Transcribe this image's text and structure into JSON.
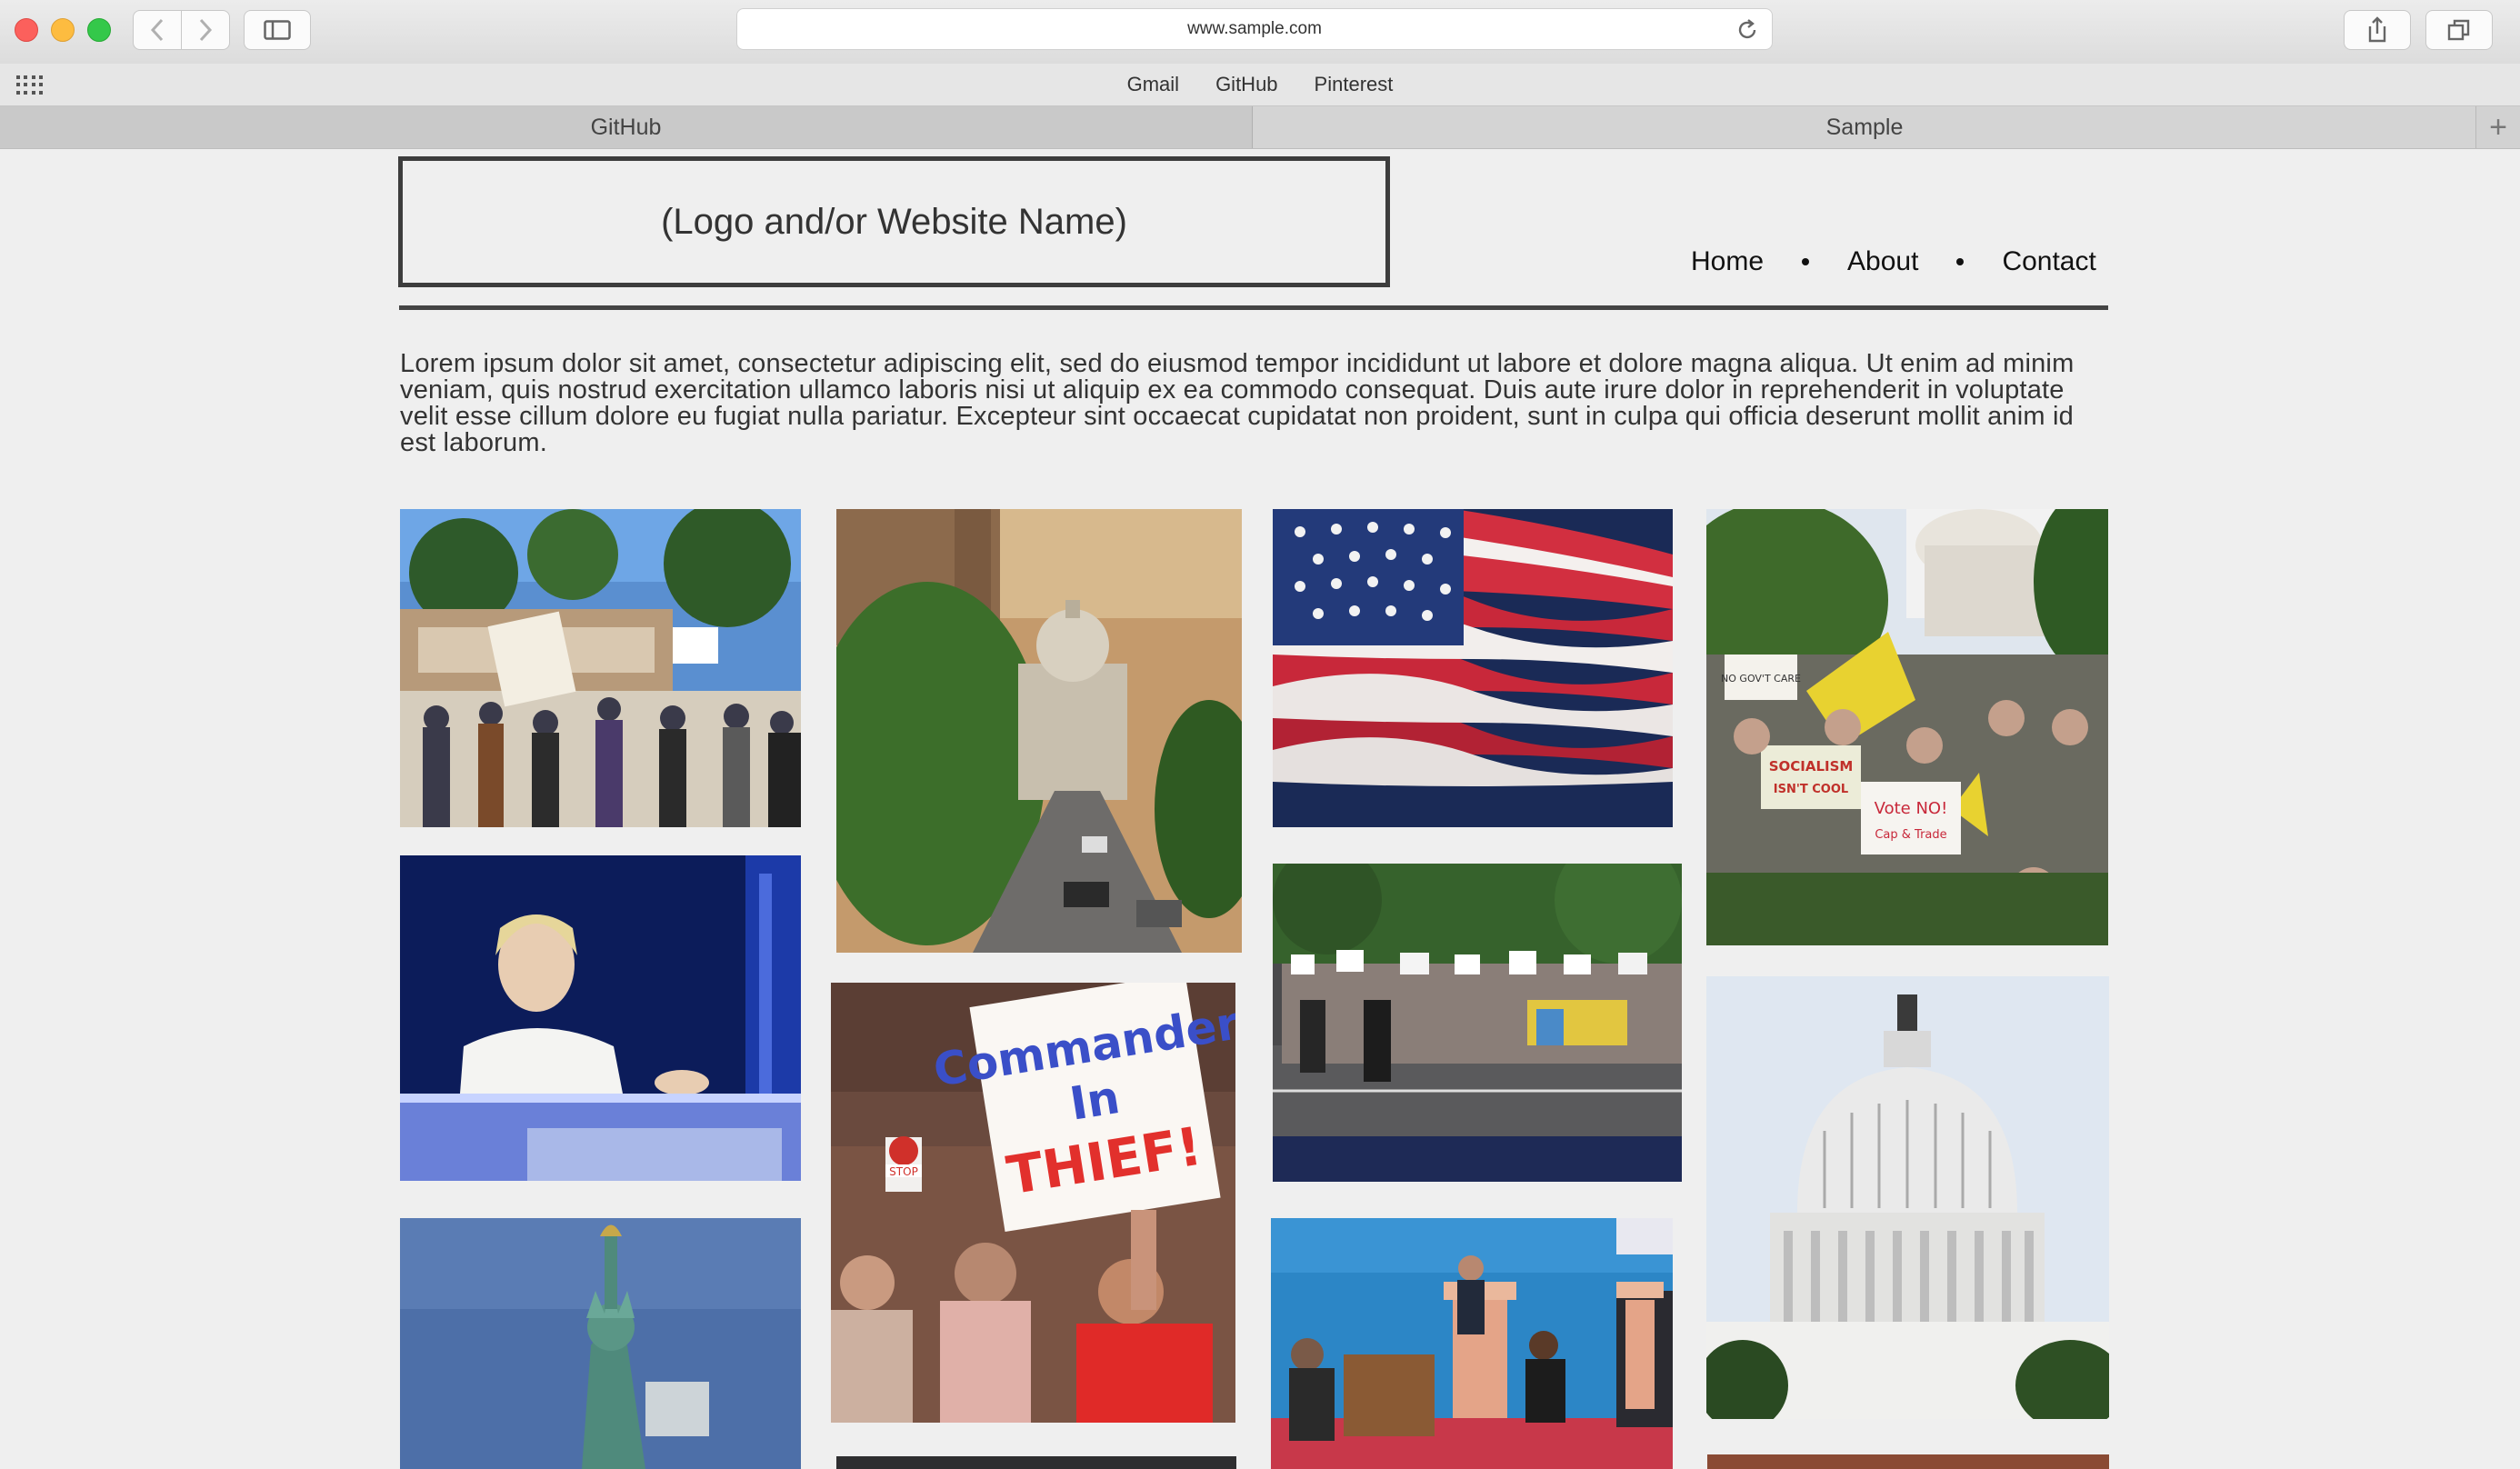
{
  "browser": {
    "url": "www.sample.com",
    "favorites": [
      "Gmail",
      "GitHub",
      "Pinterest"
    ],
    "tabs": [
      "GitHub",
      "Sample"
    ],
    "new_tab_label": "+"
  },
  "site": {
    "logo_text": "(Logo and/or Website Name)",
    "nav": [
      "Home",
      "About",
      "Contact"
    ],
    "intro": "Lorem ipsum dolor sit amet, consectetur adipiscing elit, sed do eiusmod tempor incididunt ut labore et dolore magna aliqua. Ut enim ad minim veniam, quis nostrud exercitation ullamco laboris nisi ut aliquip ex ea commodo consequat. Duis aute irure dolor in reprehenderit in voluptate velit esse cillum dolore eu fugiat nulla pariatur. Excepteur sint occaecat cupidatat non proident, sunt in culpa qui officia deserunt mollit anim id est laborum."
  },
  "gallery": {
    "sign_line1": "Commander",
    "sign_line2": "In",
    "sign_line3": "THIEF!",
    "sign_socialism": "SOCIALISM",
    "sign_isnt_cool": "ISN'T COOL",
    "sign_vote_no": "Vote NO!",
    "sign_cap_trade": "Cap & Trade",
    "sign_no_gov": "NO GOV'T CARE",
    "sign_stop": "STOP"
  }
}
